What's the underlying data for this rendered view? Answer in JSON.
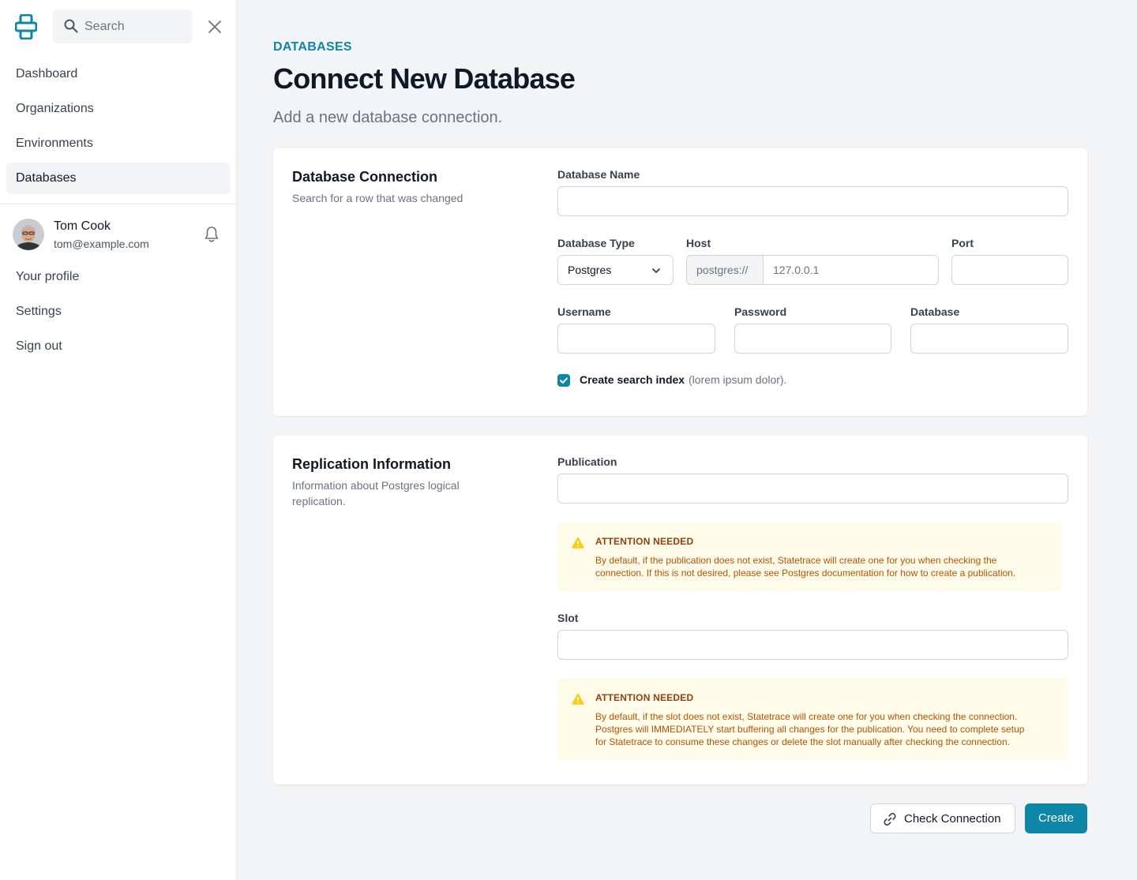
{
  "sidebar": {
    "search_placeholder": "Search",
    "nav": [
      {
        "label": "Dashboard",
        "active": false
      },
      {
        "label": "Organizations",
        "active": false
      },
      {
        "label": "Environments",
        "active": false
      },
      {
        "label": "Databases",
        "active": true
      }
    ],
    "user": {
      "name": "Tom Cook",
      "email": "tom@example.com"
    },
    "user_nav": [
      {
        "label": "Your profile"
      },
      {
        "label": "Settings"
      },
      {
        "label": "Sign out"
      }
    ]
  },
  "header": {
    "eyebrow": "DATABASES",
    "title": "Connect New Database",
    "subtitle": "Add a new database connection."
  },
  "connection": {
    "title": "Database Connection",
    "description": "Search for a row that was changed",
    "database_name_label": "Database Name",
    "database_name_value": "",
    "database_type_label": "Database Type",
    "database_type_value": "Postgres",
    "host_label": "Host",
    "host_prefix": "postgres://",
    "host_placeholder": "127.0.0.1",
    "port_label": "Port",
    "username_label": "Username",
    "password_label": "Password",
    "database_label": "Database",
    "search_index_label": "Create search index",
    "search_index_hint": "(lorem ipsum dolor).",
    "search_index_checked": true
  },
  "replication": {
    "title": "Replication Information",
    "description": "Information about Postgres logical replication.",
    "publication_label": "Publication",
    "publication_alert_title": "ATTENTION NEEDED",
    "publication_alert_lines": [
      "By default, if the publication does not exist, Statetrace will create one for you when checking the",
      "connection. If this is not desired, please see Postgres documentation for how to create a publication."
    ],
    "slot_label": "Slot",
    "slot_alert_title": "ATTENTION NEEDED",
    "slot_alert_lines": [
      "By default, if the slot does not exist, Statetrace will create one for you when checking the connection.",
      "Postgres will IMMEDIATELY start buffering all changes for the publication. You need to complete setup",
      "for Statetrace to consume these changes or delete the slot manually after checking the connection."
    ]
  },
  "actions": {
    "check_label": "Check Connection",
    "create_label": "Create"
  },
  "colors": {
    "accent": "#0e86a8",
    "alert_bg": "#fefce8",
    "alert_title": "#92400e",
    "alert_text": "#b45309",
    "warn_icon": "#facc15"
  },
  "icons": [
    "logo-icon",
    "search-icon",
    "close-icon",
    "bell-icon",
    "chevron-down-icon",
    "check-icon",
    "warning-icon",
    "link-icon"
  ]
}
